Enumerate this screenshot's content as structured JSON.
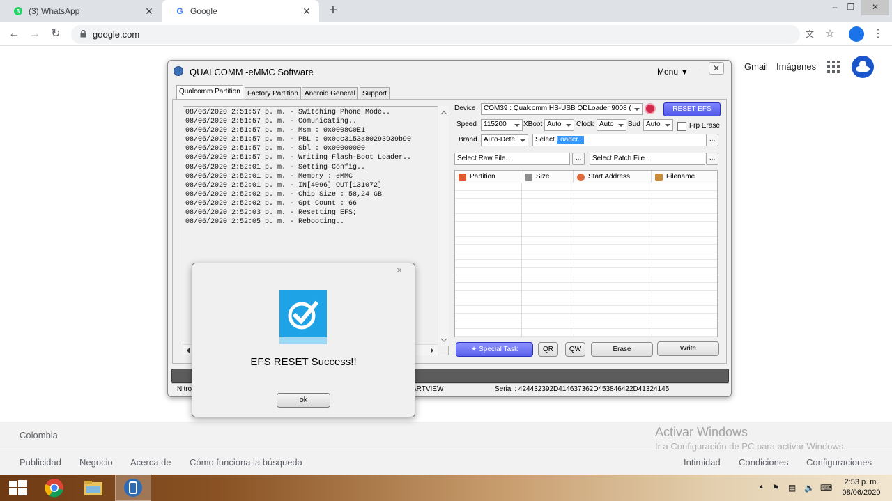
{
  "browser": {
    "tabs": [
      {
        "title": "(3) WhatsApp",
        "badge": "3",
        "close": "✕"
      },
      {
        "title": "Google",
        "favicon": "G",
        "close": "✕"
      }
    ],
    "new_tab": "+",
    "window_controls": {
      "minimize": "–",
      "restore": "❐",
      "close": "✕"
    },
    "url": "google.com"
  },
  "google": {
    "links": [
      "Gmail",
      "Imágenes"
    ],
    "country": "Colombia",
    "footer_left": [
      "Publicidad",
      "Negocio",
      "Acerca de",
      "Cómo funciona la búsqueda"
    ],
    "footer_right": [
      "Intimidad",
      "Condiciones",
      "Configuraciones"
    ]
  },
  "watermark": {
    "line1": "Activar Windows",
    "line2": "Ir a Configuración de PC para activar Windows."
  },
  "app": {
    "title": "QUALCOMM -eMMC Software",
    "menu": "Menu ▼",
    "minimize": "–",
    "close": "✕",
    "tabs": [
      "Qualcomm Partition",
      "Factory Partition",
      "Android General",
      "Support"
    ],
    "log": [
      "08/06/2020 2:51:57 p. m. - Switching Phone Mode..",
      "08/06/2020 2:51:57 p. m. - Comunicating..",
      "08/06/2020 2:51:57 p. m. - Msm : 0x0008C0E1",
      "08/06/2020 2:51:57 p. m. - PBL : 0x0cc3153a80293939b90",
      "08/06/2020 2:51:57 p. m. - Sbl : 0x00000000",
      "08/06/2020 2:51:57 p. m. - Writing Flash-Boot Loader..",
      "08/06/2020 2:52:01 p. m. - Setting Config..",
      "08/06/2020 2:52:01 p. m. - Memory : eMMC",
      "08/06/2020 2:52:01 p. m. - IN[4096] OUT[131072]",
      "08/06/2020 2:52:02 p. m. - Chip Size : 58,24 GB",
      "08/06/2020 2:52:02 p. m. - Gpt Count : 66",
      "08/06/2020 2:52:03 p. m. - Resetting EFS;",
      "08/06/2020 2:52:05 p. m. - Rebooting.."
    ],
    "device_label": "Device",
    "device_value": "COM39 : Qualcomm HS-USB QDLoader 9008 (",
    "reset_efs": "RESET EFS",
    "speed_label": "Speed",
    "speed_value": "115200",
    "xboot_label": "XBoot",
    "xboot_value": "Auto",
    "clock_label": "Clock",
    "clock_value": "Auto",
    "bud_label": "Bud",
    "bud_value": "Auto",
    "frp_label": "Frp Erase",
    "brand_label": "Brand",
    "brand_value": "Auto-Dete",
    "loader_prefix": "Select",
    "loader_highlight": "Loader...",
    "raw_file": "Select Raw File..",
    "patch_file": "Select Patch File..",
    "browse": "...",
    "columns": [
      "Partition",
      "Size",
      "Start Address",
      "Filename"
    ],
    "buttons": {
      "special": "Special Task",
      "qr": "QR",
      "qw": "QW",
      "erase": "Erase",
      "write": "Write"
    },
    "status_left": "Nitro",
    "status_mid": "ARTVIEW",
    "serial": "Serial : 424432392D414637362D453846422D41324145"
  },
  "dialog": {
    "close": "×",
    "message": "EFS RESET Success!!",
    "ok": "ok"
  },
  "taskbar": {
    "time": "2:53 p. m.",
    "date": "08/06/2020"
  },
  "colors": {
    "accent": "#1a73e8",
    "reset_button": "#5a60ea",
    "dialog_icon": "#1ea3e6"
  }
}
